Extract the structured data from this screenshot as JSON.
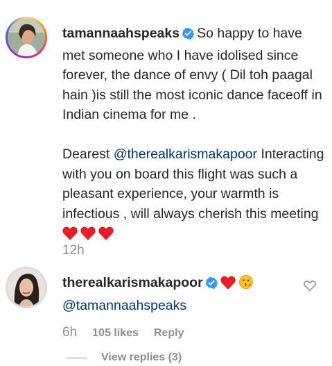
{
  "comments": [
    {
      "username": "tamannaahspeaks",
      "verified": true,
      "paragraph1": "So happy to have met someone who I have idolised since forever, the dance of envy ( Dil toh paagal hain )is still the most iconic dance faceoff in Indian cinema for me .",
      "paragraph2_prefix": "Dearest",
      "mention": "@therealkarismakapoor",
      "paragraph2_body": "Interacting with you on board this flight was such a pleasant experience, your warmth is infectious , will always cherish this meeting",
      "emoji": [
        "red-heart",
        "red-heart",
        "red-heart"
      ],
      "time": "12h"
    },
    {
      "username": "therealkarismakapoor",
      "verified": true,
      "emoji": [
        "red-heart",
        "face-blowing-kiss"
      ],
      "mention": "@tamannaahspeaks",
      "time": "6h",
      "likes": "105 likes",
      "reply_label": "Reply",
      "view_replies": "View replies (3)"
    }
  ],
  "colors": {
    "text": "#262626",
    "mention": "#00376b",
    "meta": "#8e8e8e",
    "verified_badge": "#3897f0",
    "heart": "#ed1c24"
  }
}
